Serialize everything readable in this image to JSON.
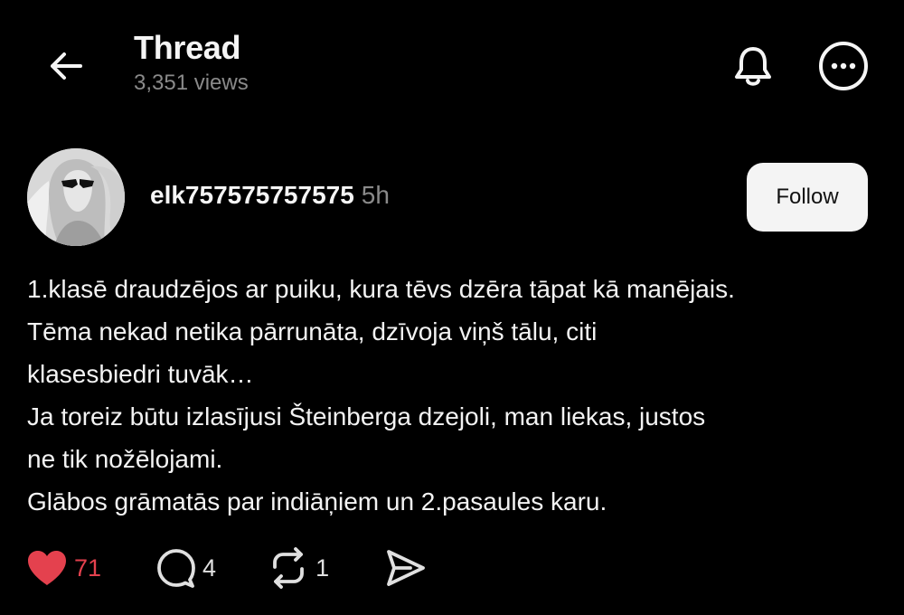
{
  "header": {
    "title": "Thread",
    "views": "3,351 views",
    "icons": {
      "back": "arrow-left-icon",
      "notifications": "bell-icon",
      "more": "more-horizontal-circle-icon"
    }
  },
  "post": {
    "username": "elk757575757575",
    "time": "5h",
    "follow_label": "Follow",
    "lines": [
      "1.klasē draudzējos ar puiku, kura tēvs dzēra tāpat kā manējais.",
      "Tēma nekad netika pārrunāta, dzīvoja viņš tālu, citi",
      "klasesbiedri tuvāk…",
      "Ja toreiz būtu izlasījusi Šteinberga dzejoli, man liekas, justos",
      "ne tik nožēlojami.",
      "Glābos grāmatās par indiāņiem un 2.pasaules karu."
    ]
  },
  "actions": {
    "likes": "71",
    "replies": "4",
    "reposts": "1",
    "icons": {
      "like": "heart-filled-icon",
      "reply": "comment-bubble-icon",
      "repost": "repost-icon",
      "share": "send-icon"
    }
  },
  "colors": {
    "background": "#000000",
    "like": "#e4414e",
    "muted": "#8a8a8a"
  }
}
